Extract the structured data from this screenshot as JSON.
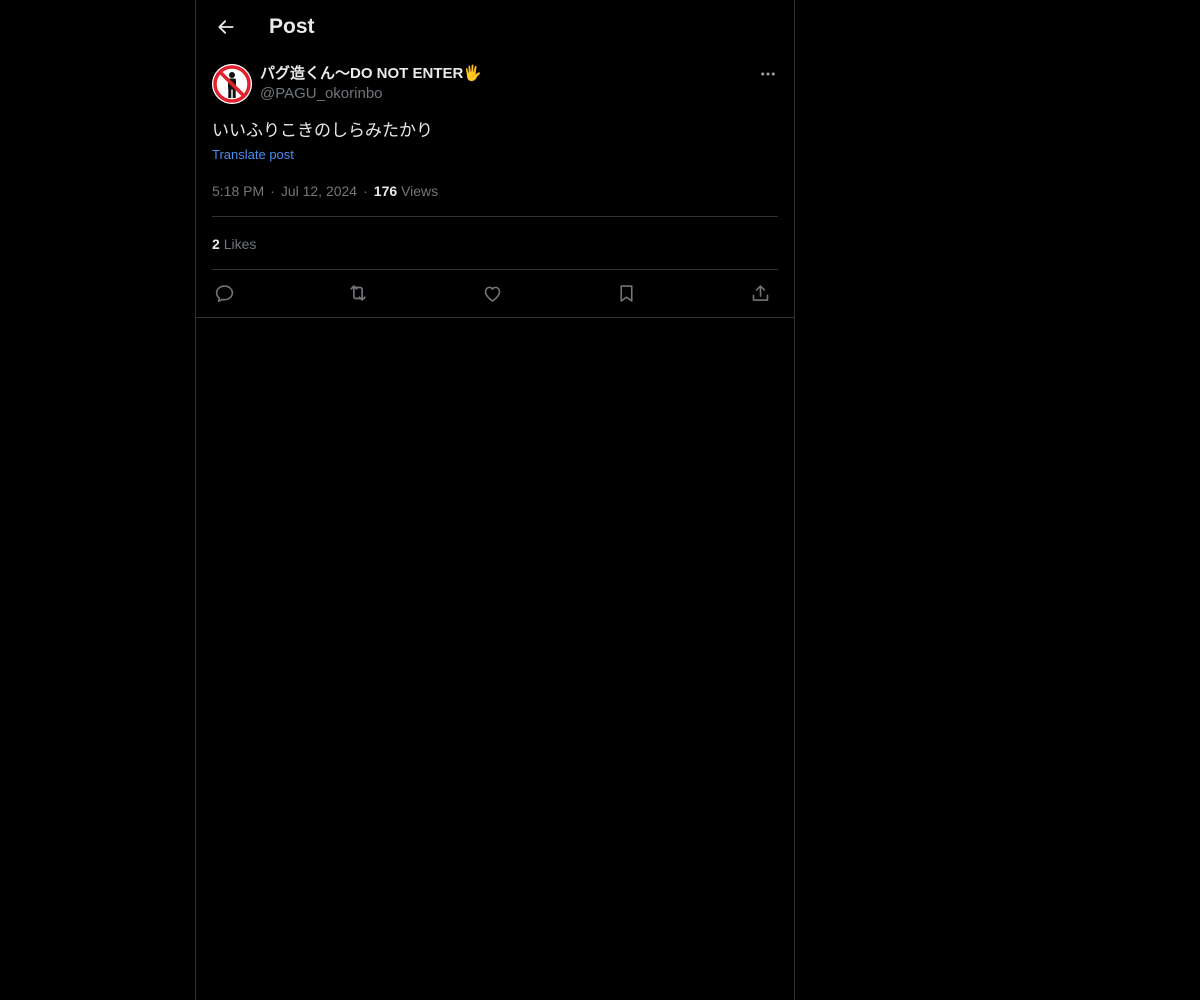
{
  "header": {
    "title": "Post"
  },
  "post": {
    "display_name": "パグ造くん〜DO NOT ENTER🖐",
    "handle": "@PAGU_okorinbo",
    "text": "いいふりこきのしらみたかり",
    "translate_label": "Translate post",
    "time": "5:18 PM",
    "date": "Jul 12, 2024",
    "views_count": "176",
    "views_label": "Views",
    "likes_count": "2",
    "likes_label": "Likes"
  },
  "icons": {
    "back": "arrow-left-icon",
    "more": "more-horizontal-icon",
    "reply": "reply-icon",
    "repost": "repost-icon",
    "like": "heart-icon",
    "bookmark": "bookmark-icon",
    "share": "share-icon"
  },
  "colors": {
    "background": "#000000",
    "text": "#e7e9ea",
    "secondary": "#71767b",
    "link": "#4a8ef0",
    "border": "#2f3336",
    "avatar_red": "#e0202a"
  }
}
